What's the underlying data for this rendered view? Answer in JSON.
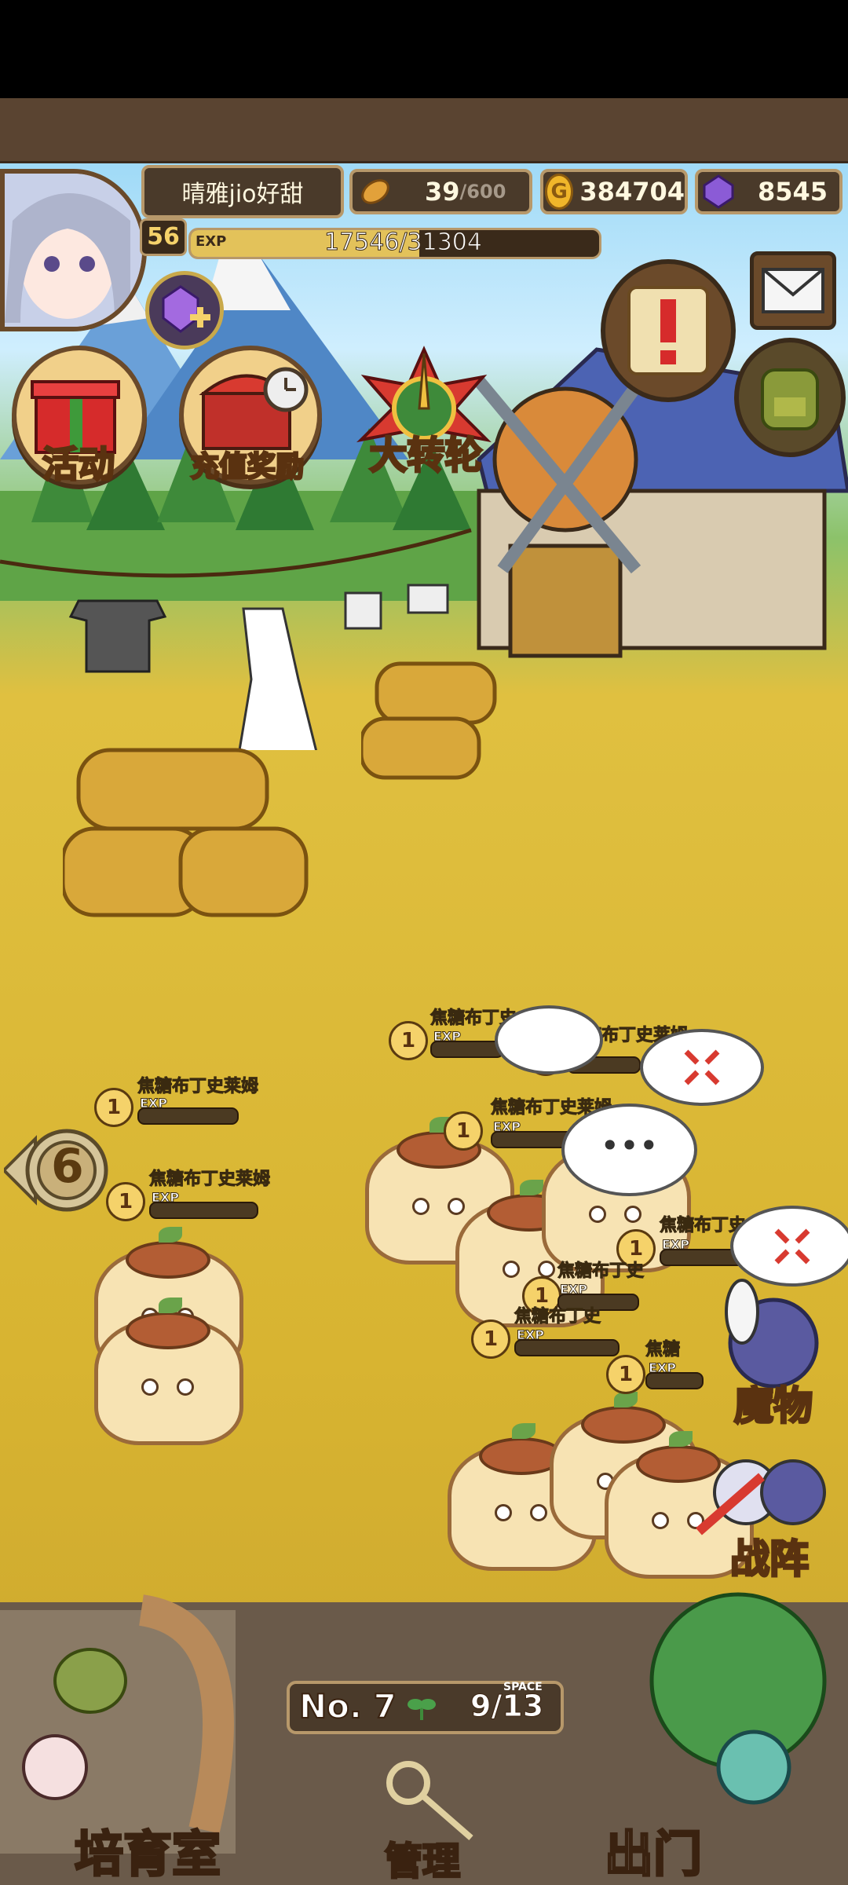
{
  "player": {
    "name": "晴雅jio好甜",
    "level": "56",
    "exp_label": "EXP",
    "exp_text": "17546/31304",
    "exp_fraction": 0.5605
  },
  "resources": {
    "bread": "39",
    "bread_max": "/600",
    "gold": "384704",
    "gems": "8545"
  },
  "menu": {
    "event": "活动",
    "recharge": "充值奖励",
    "wheel": "大转轮"
  },
  "side": {
    "monster": "魔物",
    "formation": "战阵"
  },
  "farm": {
    "number": "No. 7",
    "space_label": "SPACE",
    "space": "9/13"
  },
  "bottom": {
    "nursery": "培育室",
    "manage": "管理",
    "go_out": "出门"
  },
  "wave": "6",
  "monster_name": "焦糖布丁史莱姆",
  "monster_name_partial": "焦糖布丁史",
  "monster_name_partial2": "焦糖",
  "monster_level": "1",
  "monster_exp_label": "EXP",
  "bubble_dots": "•••",
  "colors": {
    "hud_bg": "#4a3a2a",
    "hud_border": "#b7986a",
    "exp_fill": "#e3c25a",
    "grass": "#d8b431",
    "gem": "#8b5bd6",
    "gold": "#f0b62a"
  }
}
